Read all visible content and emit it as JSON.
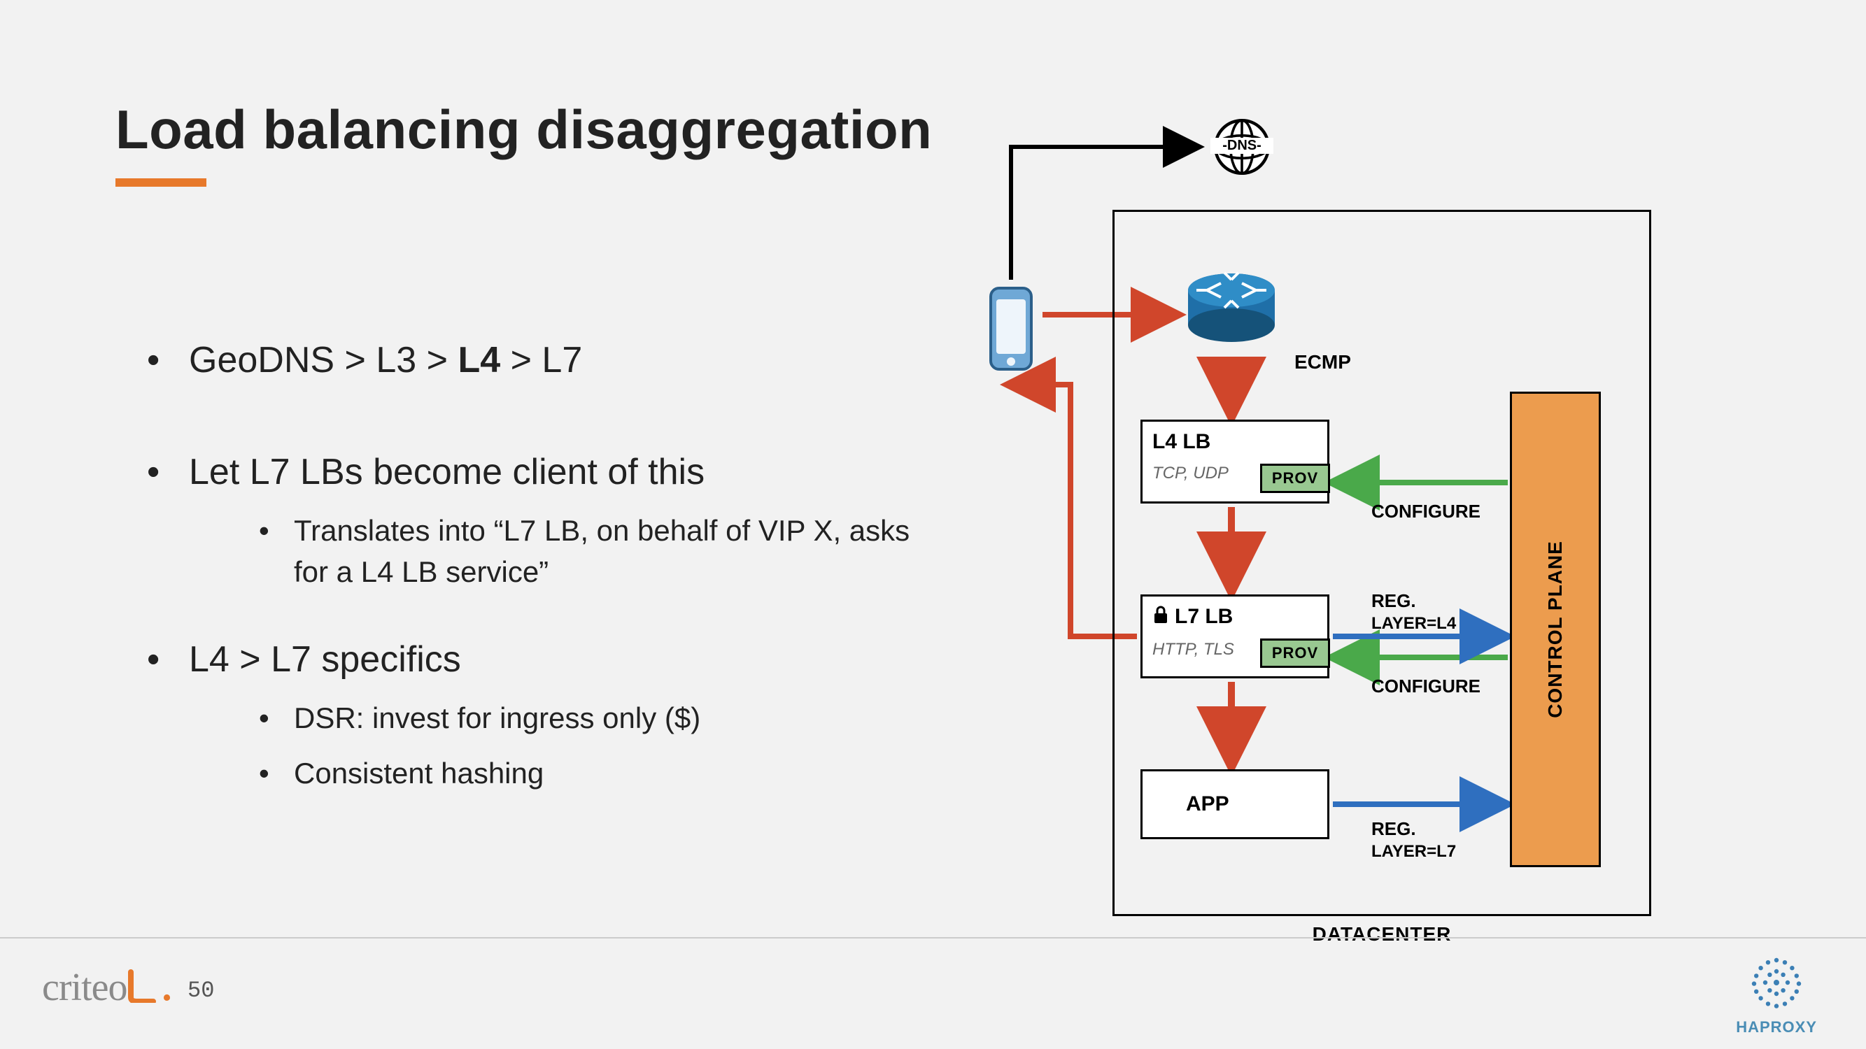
{
  "title": "Load balancing disaggregation",
  "bullets": {
    "b1_pre": "GeoDNS > L3 > ",
    "b1_bold": "L4",
    "b1_post": " > L7",
    "b2": "Let L7 LBs become client of this",
    "b2a": "Translates into “L7 LB, on behalf of VIP X, asks for a L4 LB service”",
    "b3": "L4 > L7 specifics",
    "b3a": "DSR: invest for ingress only ($)",
    "b3b": "Consistent hashing"
  },
  "diagram": {
    "dns": "DNS",
    "ecmp": "ECMP",
    "l4_title": "L4 LB",
    "l4_sub": "TCP, UDP",
    "l7_title": "L7 LB",
    "l7_sub": "HTTP, TLS",
    "app_title": "APP",
    "prov": "PROV",
    "configure": "CONFIGURE",
    "reg_line": "REG.",
    "reg_l4_layer": "LAYER=L4",
    "reg_l7_layer": "LAYER=L7",
    "cplane": "CONTROL PLANE",
    "datacenter": "DATACENTER"
  },
  "footer": {
    "criteo": "criteo",
    "page": "50",
    "haproxy": "HAPROXY"
  }
}
